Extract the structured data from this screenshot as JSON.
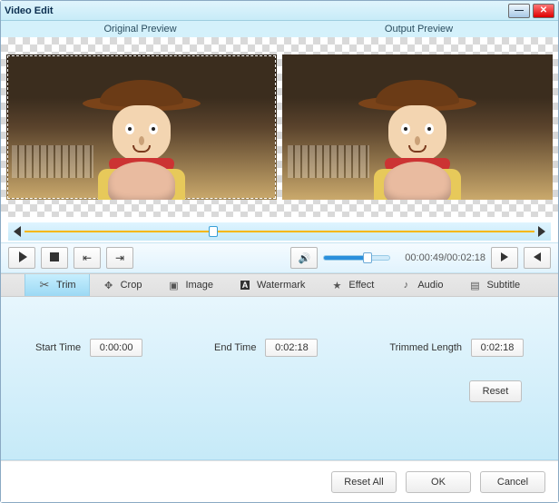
{
  "title": "Video Edit",
  "preview_labels": {
    "left": "Original Preview",
    "right": "Output Preview"
  },
  "controls": {
    "time_display": "00:00:49/00:02:18"
  },
  "tabs": {
    "trim": "Trim",
    "crop": "Crop",
    "image": "Image",
    "watermark": "Watermark",
    "effect": "Effect",
    "audio": "Audio",
    "subtitle": "Subtitle"
  },
  "fields": {
    "start_label": "Start Time",
    "start_value": "0:00:00",
    "end_label": "End Time",
    "end_value": "0:02:18",
    "length_label": "Trimmed Length",
    "length_value": "0:02:18"
  },
  "buttons": {
    "reset": "Reset",
    "reset_all": "Reset All",
    "ok": "OK",
    "cancel": "Cancel"
  }
}
